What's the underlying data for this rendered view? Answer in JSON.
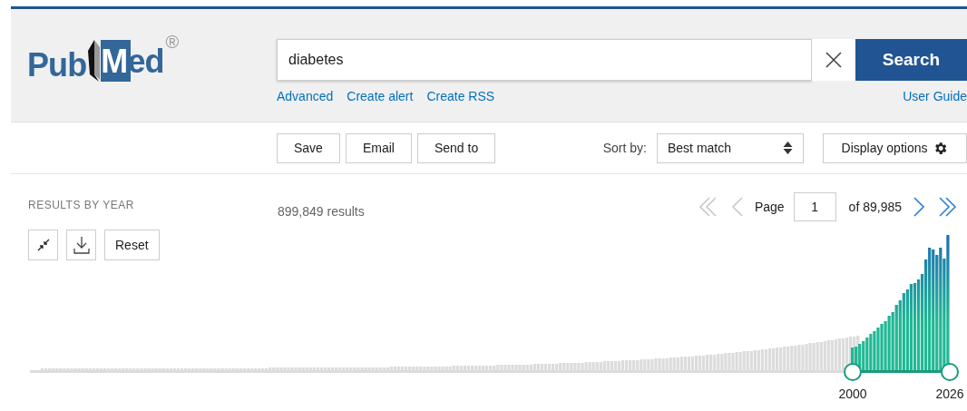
{
  "header": {
    "logo": {
      "word_1": "Pub",
      "word_2": "Med",
      "mark": "®"
    },
    "search": {
      "value": "diabetes",
      "button": "Search"
    },
    "links": [
      "Advanced",
      "Create alert",
      "Create RSS"
    ],
    "user_guide": "User Guide"
  },
  "toolbar": {
    "buttons": [
      "Save",
      "Email",
      "Send to"
    ],
    "sort_label": "Sort by:",
    "sort_value": "Best match",
    "display_options": "Display options"
  },
  "timeline": {
    "title": "RESULTS BY YEAR",
    "reset": "Reset",
    "range_labels": [
      "2000",
      "2026"
    ]
  },
  "results": {
    "count": "899,849 results",
    "pagination": {
      "page_label": "Page",
      "page": "1",
      "of": "of 89,985",
      "first_disabled": true,
      "prev_disabled": true,
      "next_disabled": false,
      "last_disabled": false
    }
  }
}
